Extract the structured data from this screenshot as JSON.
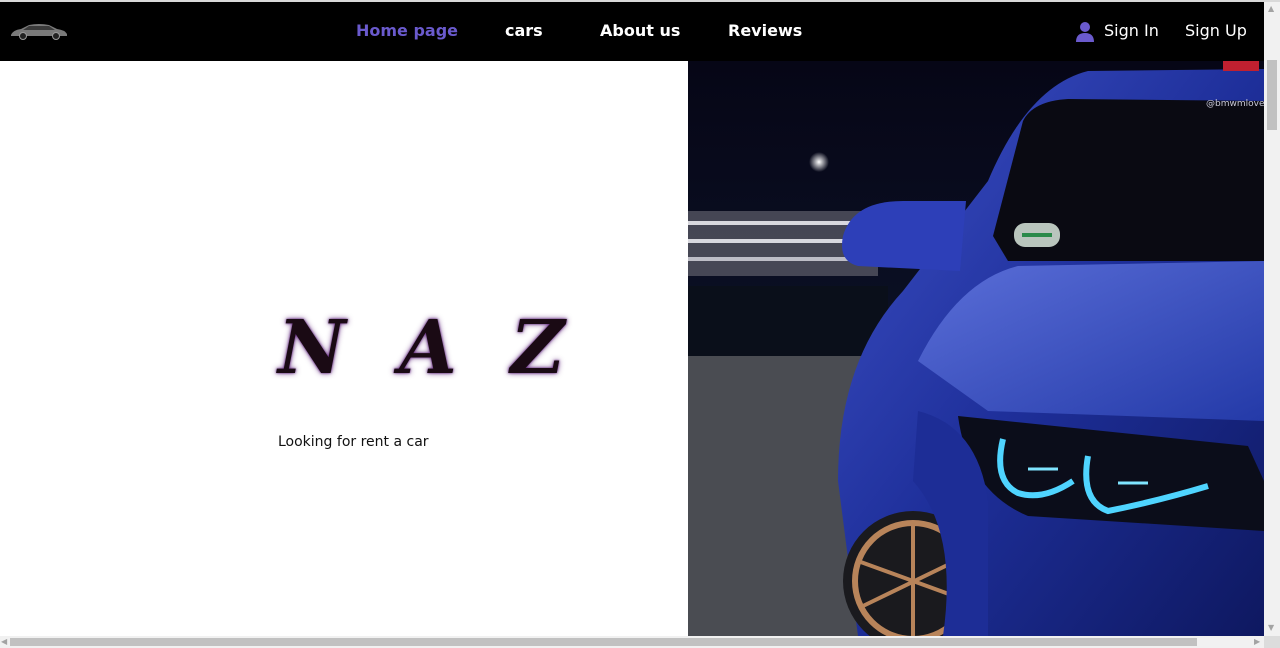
{
  "nav": {
    "logo_icon": "car-logo-icon",
    "links": [
      {
        "label": "Home page",
        "active": true
      },
      {
        "label": "cars",
        "active": false
      },
      {
        "label": "About us",
        "active": false
      },
      {
        "label": "Reviews",
        "active": false
      }
    ],
    "user_icon": "user-icon",
    "sign_in": "Sign In",
    "sign_up": "Sign Up"
  },
  "hero": {
    "brand": "N A Z",
    "tagline": "Looking for rent a car",
    "image_description_icon": "blue-sports-car-image",
    "watermark": "@bmwmlove"
  },
  "colors": {
    "nav_background": "#000000",
    "accent": "#6a5acd",
    "text_light": "#ffffff"
  }
}
